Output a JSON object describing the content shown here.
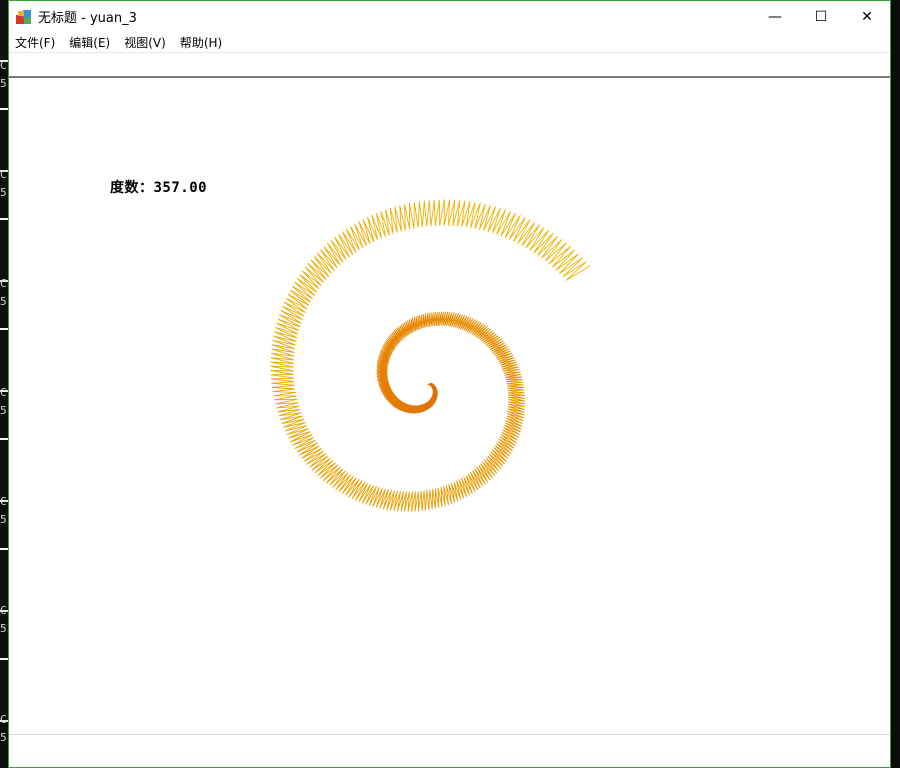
{
  "window": {
    "title": "无标题 - yuan_3",
    "minimize_glyph": "—",
    "maximize_glyph": "☐",
    "close_glyph": "✕"
  },
  "menu": {
    "items": [
      "文件(F)",
      "编辑(E)",
      "视图(V)",
      "帮助(H)"
    ]
  },
  "canvas": {
    "degree_label": "度数：357.00",
    "spiral_colors": {
      "inner": "#e06a00",
      "outer": "#f2b400"
    }
  },
  "desktop_left_chars": [
    "C",
    "5",
    "C",
    "5",
    "C",
    "5",
    "C",
    "5",
    "C",
    "5",
    "C",
    "5",
    "C",
    "5"
  ]
}
